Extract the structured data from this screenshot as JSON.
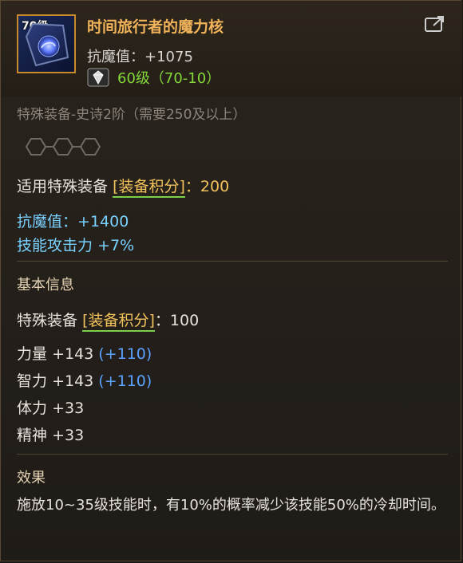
{
  "item": {
    "level_badge": "70级",
    "name": "时间旅行者的魔力核",
    "stat_label": "抗魔值",
    "stat_value": "+1075",
    "grade": "60级（70-10）"
  },
  "details": {
    "special_equipment_line": "特殊装备-史诗2阶（需要250及以上）",
    "applicable_label": "适用特殊装备",
    "applicable_tag": "[装备积分]",
    "applicable_value": "200",
    "bonus_lines": [
      {
        "label": "抗魔值",
        "value": "+1400"
      },
      {
        "label": "技能攻击力",
        "value": "+7%"
      }
    ],
    "basic_info_title": "基本信息",
    "basic_equipment_label": "特殊装备",
    "basic_equipment_tag": "[装备积分]",
    "basic_equipment_value": "100",
    "attributes": [
      {
        "label": "力量",
        "value": "+143",
        "bonus": "(+110)"
      },
      {
        "label": "智力",
        "value": "+143",
        "bonus": "(+110)"
      },
      {
        "label": "体力",
        "value": "+33",
        "bonus": ""
      },
      {
        "label": "精神",
        "value": "+33",
        "bonus": ""
      }
    ],
    "effect_title": "效果",
    "effect_text": "施放10~35级技能时，有10%的概率减少该技能50%的冷却时间。"
  },
  "colors": {
    "title": "#f0b35a",
    "grade": "#84d83a",
    "cyan": "#79d1ff",
    "blue": "#5aa2ff",
    "gold": "#f2c35c"
  },
  "icons": {
    "item_icon": "magic-core-icon",
    "grade_icon": "gem-icon",
    "export_icon": "share-icon",
    "slot_icon": "hex-slot-icon"
  }
}
